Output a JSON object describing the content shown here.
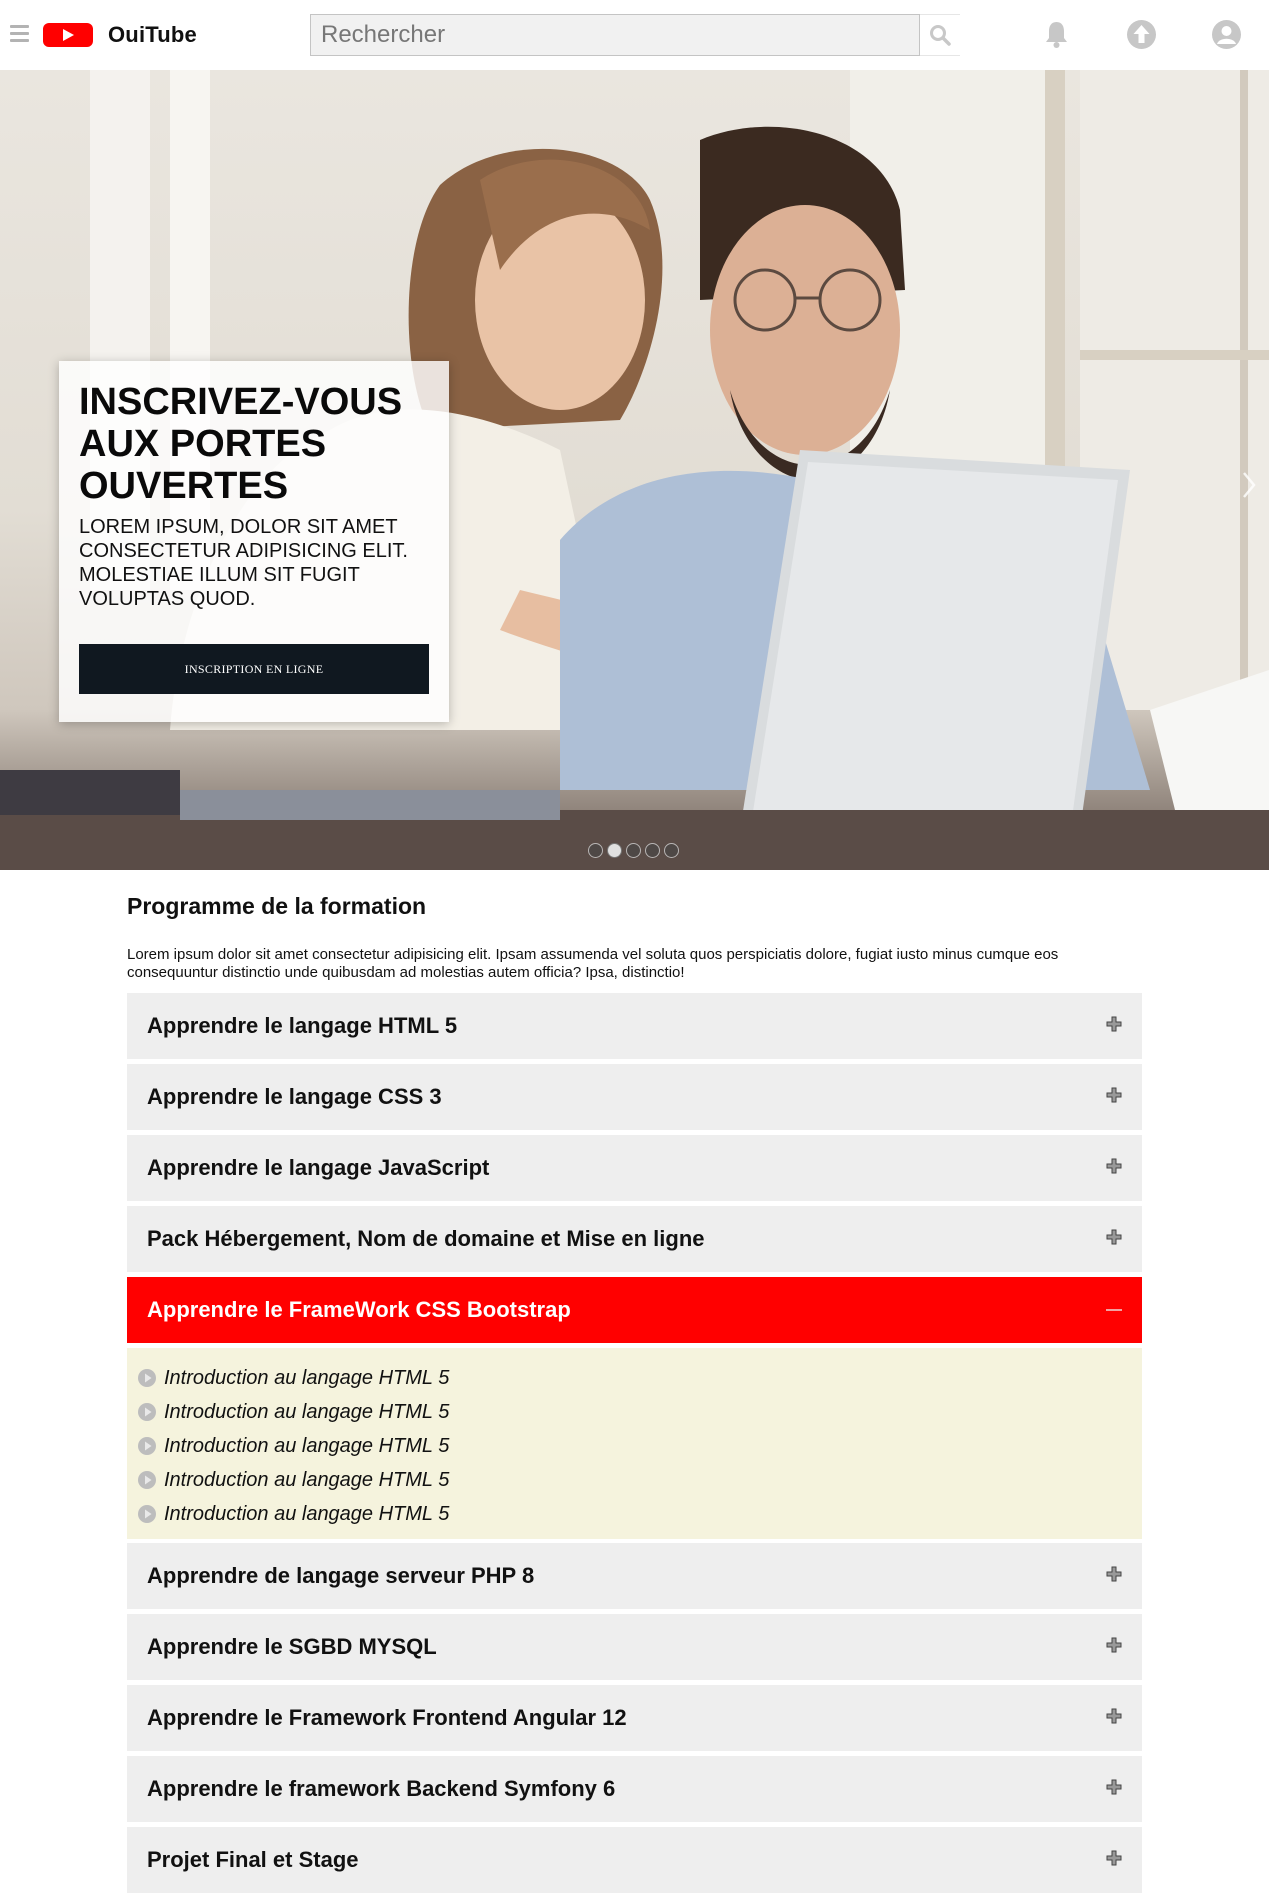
{
  "header": {
    "brand": "OuiTube",
    "search_placeholder": "Rechercher",
    "icons": [
      "menu-icon",
      "youtube-logo-icon",
      "search-icon",
      "bell-icon",
      "upload-icon",
      "account-icon"
    ]
  },
  "hero": {
    "title": "INSCRIVEZ-VOUS AUX PORTES OUVERTES",
    "text": "LOREM IPSUM, DOLOR SIT AMET CONSECTETUR ADIPISICING ELIT. MOLESTIAE ILLUM SIT FUGIT VOLUPTAS QUOD.",
    "button_label": "INSCRIPTION EN LIGNE",
    "slide_count": 5,
    "active_slide": 2
  },
  "program": {
    "title": "Programme de la formation",
    "intro": "Lorem ipsum dolor sit amet consectetur adipisicing elit. Ipsam assumenda vel soluta quos perspiciatis dolore, fugiat iusto minus cumque eos consequuntur distinctio unde quibusdam ad molestias autem officia? Ipsa, distinctio!",
    "modules": [
      {
        "label": "Apprendre le langage HTML 5",
        "expanded": false
      },
      {
        "label": "Apprendre le langage CSS 3",
        "expanded": false
      },
      {
        "label": "Apprendre le langage JavaScript",
        "expanded": false
      },
      {
        "label": "Pack Hébergement, Nom de domaine et Mise en ligne",
        "expanded": false
      },
      {
        "label": "Apprendre le FrameWork CSS Bootstrap",
        "expanded": true
      },
      {
        "label": "Apprendre de langage serveur PHP 8",
        "expanded": false
      },
      {
        "label": "Apprendre le SGBD MYSQL",
        "expanded": false
      },
      {
        "label": "Apprendre le Framework Frontend Angular 12",
        "expanded": false
      },
      {
        "label": "Apprendre le framework Backend Symfony 6",
        "expanded": false
      },
      {
        "label": "Projet Final et Stage",
        "expanded": false
      }
    ],
    "lessons": [
      "Introduction au langage HTML 5",
      "Introduction au langage HTML 5",
      "Introduction au langage HTML 5",
      "Introduction au langage HTML 5",
      "Introduction au langage HTML 5"
    ]
  },
  "colors": {
    "brand_red": "#ff0000",
    "accordion_bg": "#eeeeee",
    "lessons_bg": "#f5f3dd",
    "button_dark": "#101820"
  }
}
